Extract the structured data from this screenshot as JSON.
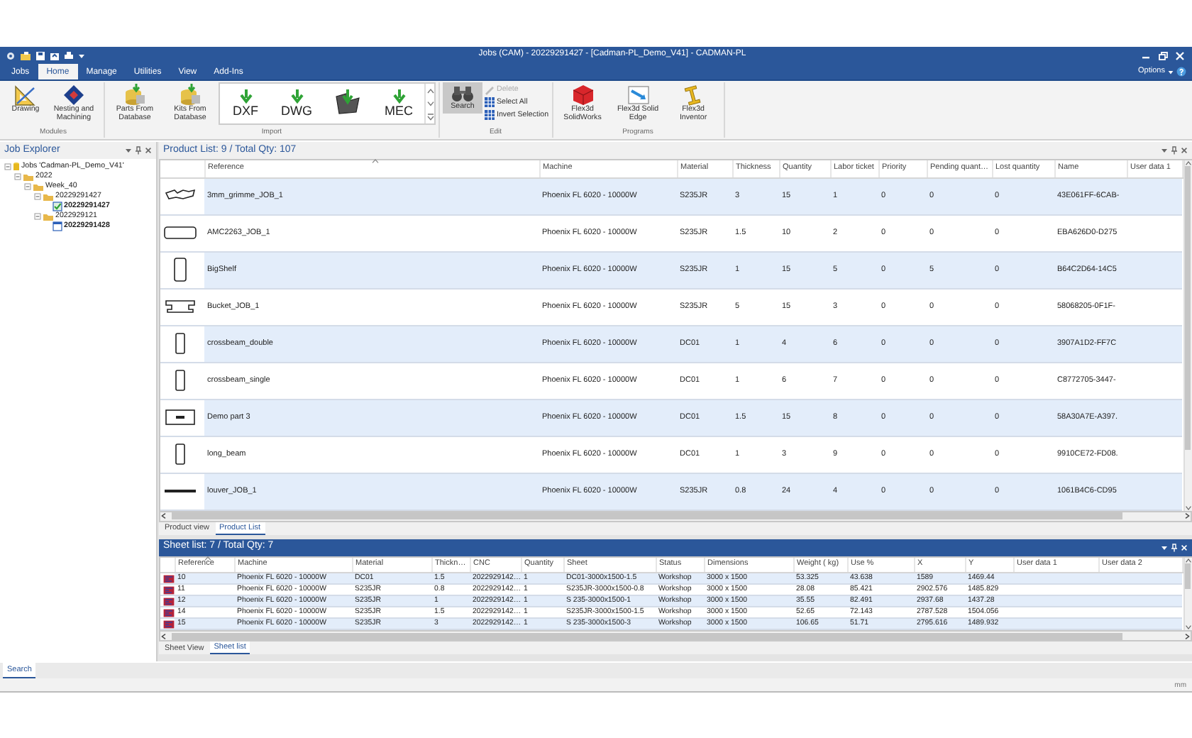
{
  "window": {
    "title": "Jobs (CAM) - 20229291427 - [Cadman-PL_Demo_V41] - CADMAN-PL"
  },
  "ribbon_tabs": [
    {
      "label": "Jobs",
      "selected": false
    },
    {
      "label": "Home",
      "selected": true
    },
    {
      "label": "Manage",
      "selected": false
    },
    {
      "label": "Utilities",
      "selected": false
    },
    {
      "label": "View",
      "selected": false
    },
    {
      "label": "Add-Ins",
      "selected": false
    }
  ],
  "options_menu": "Options",
  "ribbon_groups": [
    {
      "label": "Modules",
      "buttons": [
        {
          "kind": "drawing",
          "label": "Drawing"
        },
        {
          "kind": "nesting",
          "label": "Nesting and Machining"
        }
      ]
    },
    {
      "label": "Import",
      "buttons": [
        {
          "kind": "database",
          "label": "Parts From Database"
        },
        {
          "kind": "database",
          "label": "Kits From Database"
        },
        {
          "kind": "gallery",
          "items": [
            {
              "kind": "format",
              "label": "DXF"
            },
            {
              "kind": "format",
              "label": "DWG"
            },
            {
              "kind": "shape"
            },
            {
              "kind": "format",
              "label": "MEC"
            }
          ]
        }
      ]
    },
    {
      "label": "Edit",
      "buttons": [
        {
          "kind": "search",
          "label": "Search",
          "pressed": true
        },
        {
          "kind": "stack",
          "items": [
            {
              "kind": "delete",
              "label": "Delete",
              "disabled": true
            },
            {
              "kind": "select",
              "label": "Select All",
              "disabled": false
            },
            {
              "kind": "select",
              "label": "Invert Selection",
              "disabled": false
            }
          ]
        }
      ]
    },
    {
      "label": "Programs",
      "buttons": [
        {
          "kind": "solidworks",
          "label": "Flex3d SolidWorks"
        },
        {
          "kind": "solidedge",
          "label": "Flex3d Solid Edge"
        },
        {
          "kind": "inventor",
          "label": "Flex3d Inventor"
        }
      ]
    }
  ],
  "job_explorer": {
    "title": "Job Explorer",
    "tree": [
      {
        "label": "Jobs 'Cadman-PL_Demo_V41'",
        "kind": "database",
        "expanded": true,
        "children": [
          {
            "label": "2022",
            "kind": "folder",
            "expanded": true,
            "children": [
              {
                "label": "Week_40",
                "kind": "folder",
                "expanded": true,
                "children": [
                  {
                    "label": "20229291427",
                    "kind": "folder",
                    "expanded": true,
                    "children": [
                      {
                        "label": "20229291427",
                        "kind": "job-done"
                      }
                    ]
                  },
                  {
                    "label": "2022929121",
                    "kind": "folder",
                    "expanded": true,
                    "children": [
                      {
                        "label": "20229291428",
                        "kind": "job"
                      }
                    ]
                  }
                ]
              }
            ]
          }
        ]
      }
    ]
  },
  "product_list": {
    "title": "Product List: 9 / Total Qty: 107",
    "columns": [
      {
        "label": "Reference",
        "sorted": true
      },
      {
        "label": "Machine"
      },
      {
        "label": "Material"
      },
      {
        "label": "Thickness"
      },
      {
        "label": "Quantity"
      },
      {
        "label": "Labor ticket"
      },
      {
        "label": "Priority"
      },
      {
        "label": "Pending quant…"
      },
      {
        "label": "Lost quantity"
      },
      {
        "label": "Name"
      },
      {
        "label": "User data 1"
      }
    ],
    "rows": [
      [
        "3mm_grimme_JOB_1",
        "Phoenix FL 6020 - 10000W",
        "S235JR",
        "3",
        "15",
        "1",
        "0",
        "0",
        "0",
        "43E061FF-6CAB-"
      ],
      [
        "AMC2263_JOB_1",
        "Phoenix FL 6020 - 10000W",
        "S235JR",
        "1.5",
        "10",
        "2",
        "0",
        "0",
        "0",
        "EBA626D0-D275"
      ],
      [
        "BigShelf",
        "Phoenix FL 6020 - 10000W",
        "S235JR",
        "1",
        "15",
        "5",
        "0",
        "5",
        "0",
        "B64C2D64-14C5"
      ],
      [
        "Bucket_JOB_1",
        "Phoenix FL 6020 - 10000W",
        "S235JR",
        "5",
        "15",
        "3",
        "0",
        "0",
        "0",
        "58068205-0F1F-"
      ],
      [
        "crossbeam_double",
        "Phoenix FL 6020 - 10000W",
        "DC01",
        "1",
        "4",
        "6",
        "0",
        "0",
        "0",
        "3907A1D2-FF7C"
      ],
      [
        "crossbeam_single",
        "Phoenix FL 6020 - 10000W",
        "DC01",
        "1",
        "6",
        "7",
        "0",
        "0",
        "0",
        "C8772705-3447-"
      ],
      [
        "Demo part 3",
        "Phoenix FL 6020 - 10000W",
        "DC01",
        "1.5",
        "15",
        "8",
        "0",
        "0",
        "0",
        "58A30A7E-A397."
      ],
      [
        "long_beam",
        "Phoenix FL 6020 - 10000W",
        "DC01",
        "1",
        "3",
        "9",
        "0",
        "0",
        "0",
        "9910CE72-FD08."
      ],
      [
        "louver_JOB_1",
        "Phoenix FL 6020 - 10000W",
        "S235JR",
        "0.8",
        "24",
        "4",
        "0",
        "0",
        "0",
        "1061B4C6-CD95"
      ]
    ],
    "tabs": [
      {
        "label": "Product view",
        "selected": false
      },
      {
        "label": "Product List",
        "selected": true
      }
    ]
  },
  "sheet_list": {
    "title": "Sheet list: 7 / Total Qty: 7",
    "columns": [
      {
        "label": "Reference",
        "sorted": true
      },
      {
        "label": "Machine"
      },
      {
        "label": "Material"
      },
      {
        "label": "Thickn…"
      },
      {
        "label": "CNC"
      },
      {
        "label": "Quantity"
      },
      {
        "label": "Sheet"
      },
      {
        "label": "Status"
      },
      {
        "label": "Dimensions"
      },
      {
        "label": "Weight ( kg)"
      },
      {
        "label": "Use %"
      },
      {
        "label": "X"
      },
      {
        "label": "Y"
      },
      {
        "label": "User data 1"
      },
      {
        "label": "User data 2"
      }
    ],
    "rows": [
      [
        "10",
        "Phoenix FL 6020 - 10000W",
        "DC01",
        "1.5",
        "2022929142…",
        "1",
        "DC01-3000x1500-1.5",
        "Workshop",
        "3000 x 1500",
        "53.325",
        "43.638",
        "1589",
        "1469.44"
      ],
      [
        "11",
        "Phoenix FL 6020 - 10000W",
        "S235JR",
        "0.8",
        "2022929142…",
        "1",
        "S235JR-3000x1500-0.8",
        "Workshop",
        "3000 x 1500",
        "28.08",
        "85.421",
        "2902.576",
        "1485.829"
      ],
      [
        "12",
        "Phoenix FL 6020 - 10000W",
        "S235JR",
        "1",
        "2022929142…",
        "1",
        "S 235-3000x1500-1",
        "Workshop",
        "3000 x 1500",
        "35.55",
        "82.491",
        "2937.68",
        "1437.28"
      ],
      [
        "14",
        "Phoenix FL 6020 - 10000W",
        "S235JR",
        "1.5",
        "2022929142…",
        "1",
        "S235JR-3000x1500-1.5",
        "Workshop",
        "3000 x 1500",
        "52.65",
        "72.143",
        "2787.528",
        "1504.056"
      ],
      [
        "15",
        "Phoenix FL 6020 - 10000W",
        "S235JR",
        "3",
        "2022929142…",
        "1",
        "S 235-3000x1500-3",
        "Workshop",
        "3000 x 1500",
        "106.65",
        "51.71",
        "2795.616",
        "1489.932"
      ]
    ],
    "tabs": [
      {
        "label": "Sheet View",
        "selected": false
      },
      {
        "label": "Sheet list",
        "selected": true
      }
    ]
  },
  "bottom_tabs": [
    {
      "label": "Search",
      "selected": true
    }
  ],
  "status_bar": {
    "units": "mm"
  }
}
